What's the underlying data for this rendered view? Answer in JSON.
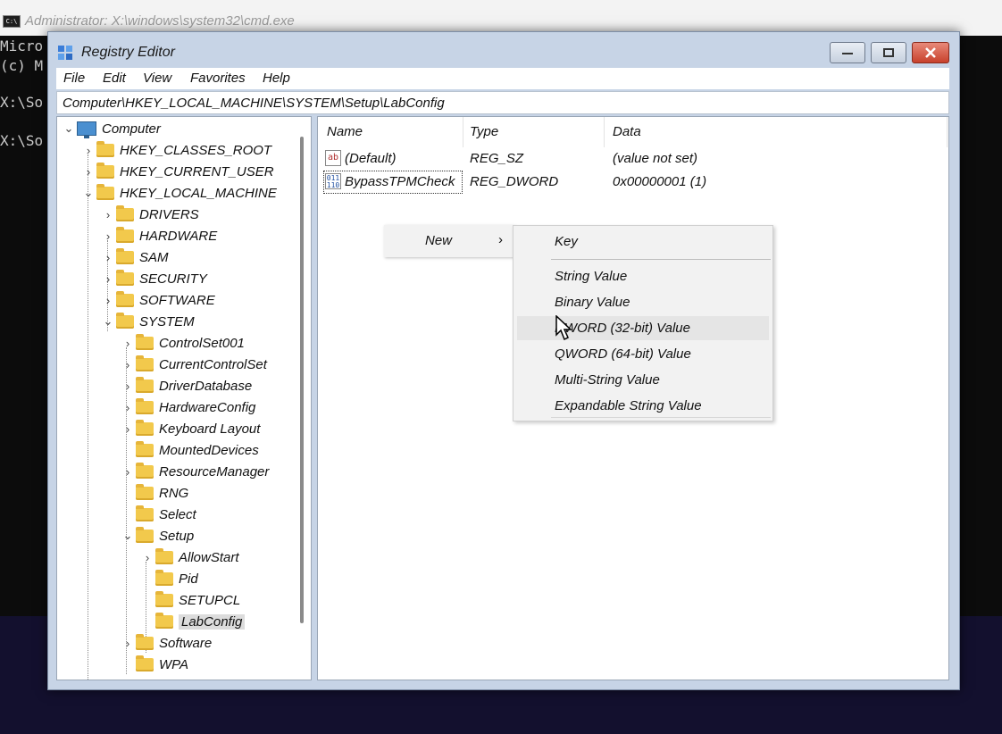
{
  "cmd": {
    "title": "Administrator: X:\\windows\\system32\\cmd.exe",
    "lines": [
      "Micro",
      "(c) M",
      "X:\\So",
      "X:\\So"
    ]
  },
  "window": {
    "title": "Registry Editor",
    "menu": [
      "File",
      "Edit",
      "View",
      "Favorites",
      "Help"
    ],
    "address": "Computer\\HKEY_LOCAL_MACHINE\\SYSTEM\\Setup\\LabConfig"
  },
  "tree": {
    "computer": "Computer",
    "hkcr": "HKEY_CLASSES_ROOT",
    "hkcu": "HKEY_CURRENT_USER",
    "hklm": "HKEY_LOCAL_MACHINE",
    "drivers": "DRIVERS",
    "hardware": "HARDWARE",
    "sam": "SAM",
    "security": "SECURITY",
    "software_hklm": "SOFTWARE",
    "system": "SYSTEM",
    "controlset001": "ControlSet001",
    "currentcontrolset": "CurrentControlSet",
    "driverdatabase": "DriverDatabase",
    "hardwareconfig": "HardwareConfig",
    "keyboardlayout": "Keyboard Layout",
    "mounteddevices": "MountedDevices",
    "resourcemanager": "ResourceManager",
    "rng": "RNG",
    "select": "Select",
    "setup": "Setup",
    "allowstart": "AllowStart",
    "pid": "Pid",
    "setupcl": "SETUPCL",
    "labconfig": "LabConfig",
    "software_sys": "Software",
    "wpa": "WPA"
  },
  "list": {
    "columns": {
      "name": "Name",
      "type": "Type",
      "data": "Data"
    },
    "rows": [
      {
        "icon": "ab",
        "name": "(Default)",
        "type": "REG_SZ",
        "data": "(value not set)"
      },
      {
        "icon": "011 110",
        "name": "BypassTPMCheck",
        "type": "REG_DWORD",
        "data": "0x00000001 (1)"
      }
    ]
  },
  "context_menu": {
    "new": "New",
    "submenu_arrow": "›",
    "items": {
      "key": "Key",
      "string": "String Value",
      "binary": "Binary Value",
      "dword": "DWORD (32-bit) Value",
      "qword": "QWORD (64-bit) Value",
      "multistring": "Multi-String Value",
      "expandable": "Expandable String Value"
    }
  },
  "colors": {
    "folder": "#f2c94c",
    "window_frame": "#c7d4e6",
    "close_button": "#c8412c"
  }
}
